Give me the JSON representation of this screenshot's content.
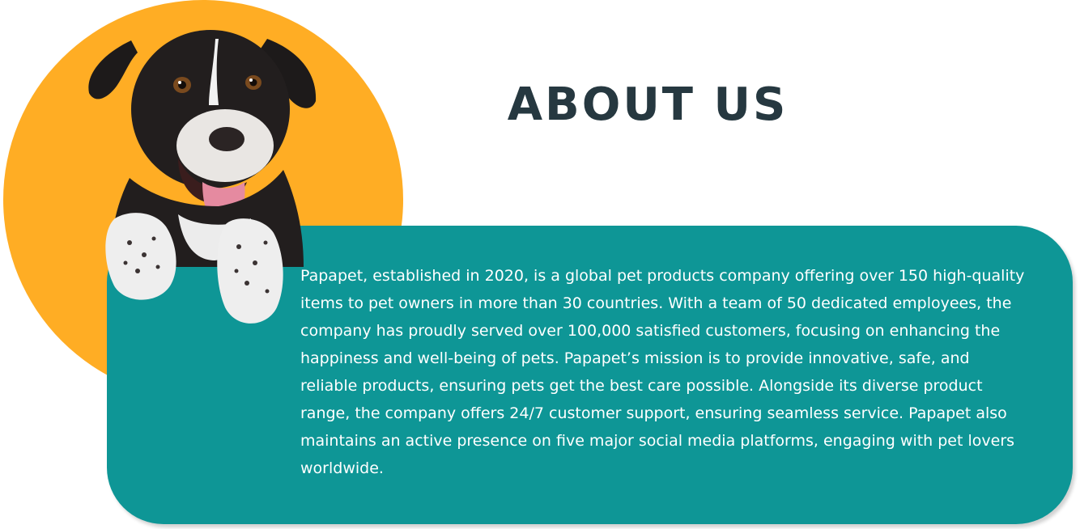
{
  "header": {
    "title": "ABOUT US"
  },
  "about": {
    "body": "Papapet, established in 2020, is a global pet products company offering over 150 high-quality items to pet owners in more than 30 countries. With a team of 50 dedicated employees, the company has proudly served over 100,000 satisfied customers, focusing on enhancing the happiness and well-being of pets. Papapet’s mission is to provide innovative, safe, and reliable products, ensuring pets get the best care possible. Alongside its diverse product range, the company offers 24/7 customer support, ensuring seamless service. Papapet also maintains an active presence on five major social media platforms, engaging with pet lovers worldwide."
  },
  "colors": {
    "accent_orange": "#FFAD24",
    "card_teal": "#0E9696",
    "heading_dark": "#263840",
    "text_white": "#FFFFFF"
  },
  "images": {
    "hero": "puppy-illustration"
  }
}
